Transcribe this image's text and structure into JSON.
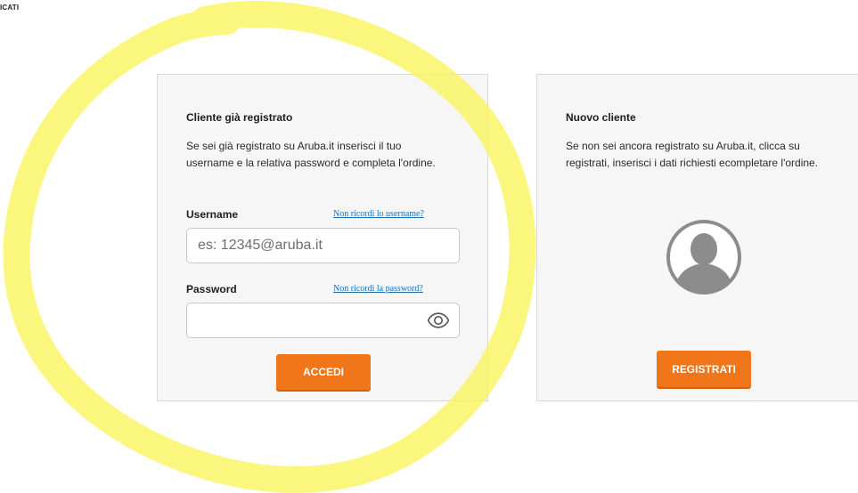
{
  "header": {
    "corner_label": "ICATI"
  },
  "login": {
    "title": "Cliente già registrato",
    "description": "Se sei già registrato su Aruba.it inserisci il tuo username e la relativa password e completa l'ordine.",
    "username_label": "Username",
    "username_forgot": "Non ricordi lo username?",
    "username_placeholder": "es: 12345@aruba.it",
    "username_value": "",
    "password_label": "Password",
    "password_forgot": "Non ricordi la password?",
    "password_value": "",
    "submit_label": "ACCEDI"
  },
  "register": {
    "title": "Nuovo cliente",
    "description": "Se non sei ancora registrato su Aruba.it, clicca su registrati, inserisci i dati richiesti ecompletare l'ordine.",
    "avatar_icon": "user-silhouette-icon",
    "submit_label": "REGISTRATI"
  },
  "icons": {
    "password_toggle": "eye-icon"
  },
  "colors": {
    "accent": "#f07619",
    "link": "#1a6fb5",
    "panel_bg": "#f6f6f6",
    "highlight": "#faf45a"
  }
}
